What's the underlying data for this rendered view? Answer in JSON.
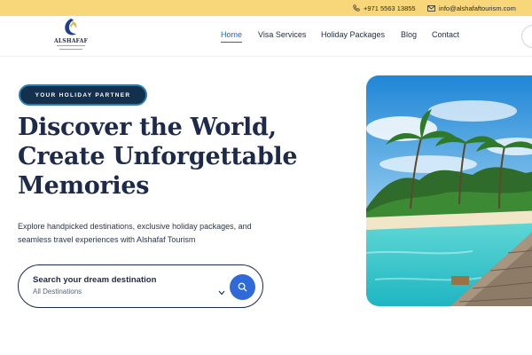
{
  "topbar": {
    "phone": "+971 5563 13855",
    "email": "info@alshafaftourism.com",
    "bg_color": "#f7d77a"
  },
  "logo": {
    "name": "ALSHAFAF"
  },
  "nav": {
    "items": [
      {
        "label": "Home",
        "active": true
      },
      {
        "label": "Visa Services"
      },
      {
        "label": "Holiday Packages"
      },
      {
        "label": "Blog"
      },
      {
        "label": "Contact"
      }
    ],
    "active_color": "#2563c9"
  },
  "hero": {
    "badge": "YOUR HOLIDAY PARTNER",
    "title_lines": [
      "Discover the World,",
      "Create Unforgettable",
      "Memories"
    ],
    "description_lines": [
      "Explore handpicked destinations, exclusive holiday packages, and",
      "seamless travel experiences with Alshafaf Tourism"
    ],
    "search": {
      "label": "Search your dream destination",
      "selected": "All Destinations",
      "button_color": "#2f6ad8"
    }
  },
  "icons": {
    "phone": "phone-icon",
    "email": "mail-icon",
    "search": "search-icon",
    "chevron": "chevron-down-icon"
  }
}
